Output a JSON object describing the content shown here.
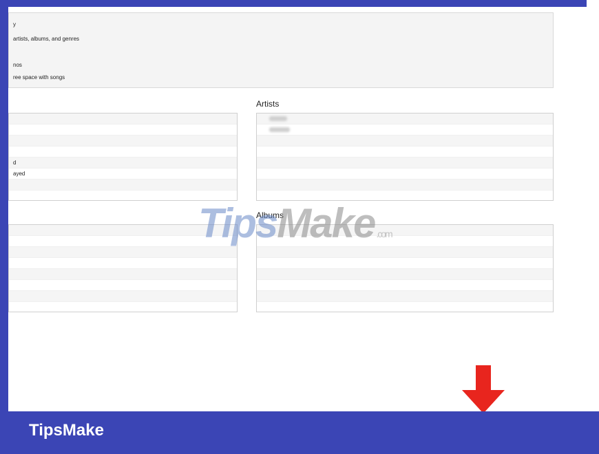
{
  "options": {
    "line1": "y",
    "line2": "artists, albums, and genres",
    "line3": "nos",
    "line4": "ree space with songs"
  },
  "left_list_top": {
    "rows": [
      "",
      "",
      "",
      "",
      "d",
      "ayed",
      "",
      ""
    ]
  },
  "artists": {
    "title": "Artists",
    "rows": [
      "",
      "",
      "",
      "",
      "",
      "",
      "",
      ""
    ]
  },
  "left_list_bottom": {
    "rows": [
      "",
      "",
      "",
      "",
      "",
      "",
      "",
      ""
    ]
  },
  "albums": {
    "title": "Albums",
    "rows": [
      "",
      "",
      "",
      "",
      "",
      "",
      "",
      ""
    ]
  },
  "watermark": {
    "tips": "Tips",
    "make": "Make",
    "com": ".com"
  },
  "footer": {
    "brand": "TipsMake"
  },
  "colors": {
    "frame": "#3b45b5",
    "arrow": "#e8251e"
  },
  "icons": {
    "arrow": "arrow-down-icon"
  }
}
